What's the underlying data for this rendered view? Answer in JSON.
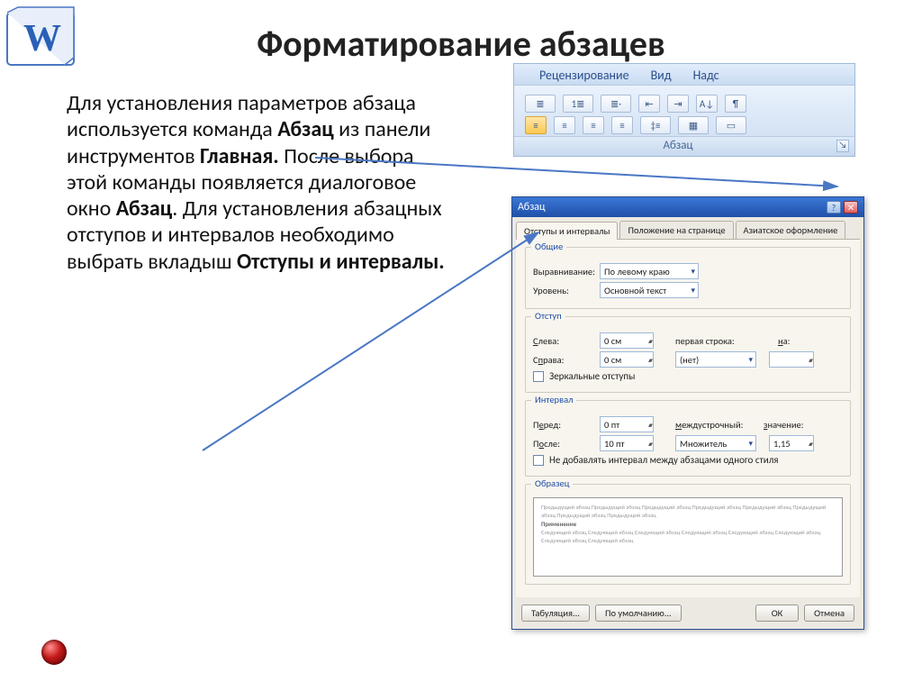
{
  "slide": {
    "title": "Форматирование абзацев",
    "body_parts": {
      "p1": "Для установления параметров абзаца используется команда ",
      "b1": "Абзац",
      "p2": " из панели инструментов ",
      "b2": "Главная.",
      "p3": " После выбора этой команды появляется диалоговое окно ",
      "b3": "Абзац",
      "p4": ". Для установления абзацных отступов и интервалов необходимо выбрать вкладыш ",
      "b4": "Отступы и интервалы."
    }
  },
  "ribbon": {
    "tabs": [
      "Рецензирование",
      "Вид",
      "Надс"
    ],
    "group_label": "Абзац",
    "icons_row1": [
      "bullets",
      "numbering",
      "multilevel",
      "indent-dec",
      "indent-inc",
      "sort",
      "pilcrow"
    ],
    "icons_row2": [
      "align-left",
      "align-center",
      "align-right",
      "justify",
      "line-spacing",
      "shading",
      "borders"
    ],
    "glyphs_row1": [
      "≣",
      "1≣",
      "≣·",
      "⇤",
      "⇥",
      "A↓",
      "¶"
    ],
    "glyphs_row2": [
      "≡",
      "≡",
      "≡",
      "≡",
      "‡≡",
      "▦",
      "▭"
    ]
  },
  "dialog": {
    "title": "Абзац",
    "tabs": [
      "Отступы и интервалы",
      "Положение на странице",
      "Азиатское оформление"
    ],
    "groups": {
      "general": {
        "label": "Общие",
        "align_label": "Выравнивание:",
        "align_value": "По левому краю",
        "level_label": "Уровень:",
        "level_value": "Основной текст"
      },
      "indent": {
        "label": "Отступ",
        "left_label": "Слева:",
        "left_value": "0 см",
        "right_label": "Справа:",
        "right_value": "0 см",
        "firstline_label": "первая строка:",
        "firstline_value": "(нет)",
        "by_label": "на:",
        "by_value": "",
        "mirror_label": "Зеркальные отступы"
      },
      "spacing": {
        "label": "Интервал",
        "before_label": "Перед:",
        "before_value": "0 пт",
        "after_label": "После:",
        "after_value": "10 пт",
        "line_label": "междустрочный:",
        "line_value": "Множитель",
        "at_label": "значение:",
        "at_value": "1,15",
        "noextra_label": "Не добавлять интервал между абзацами одного стиля"
      },
      "sample": {
        "label": "Образец",
        "prev_text": "Предыдущий абзац Предыдущий абзац Предыдущий абзац Предыдущий абзац Предыдущий абзац Предыдущий абзац Предыдущий абзац Предыдущий абзац",
        "sample_text": "Применение",
        "next_text": "Следующий абзац Следующий абзац Следующий абзац Следующий абзац Следующий абзац Следующий абзац Следующий абзац Следующий абзац"
      }
    },
    "buttons": {
      "tabs": "Табуляция...",
      "default": "По умолчанию...",
      "ok": "ОК",
      "cancel": "Отмена"
    }
  }
}
